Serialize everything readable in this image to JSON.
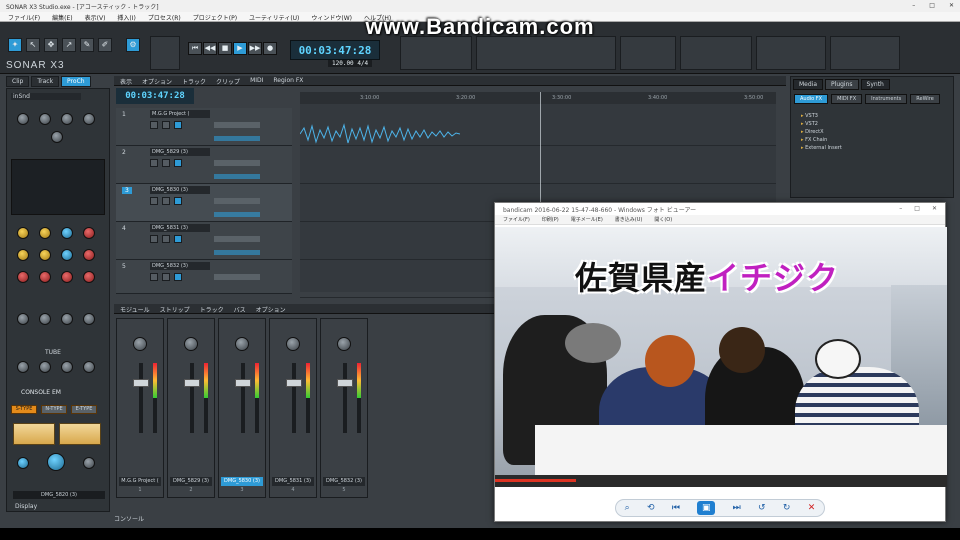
{
  "watermark": "www.Bandicam.com",
  "app": {
    "title": "SONAR X3 Studio.exe - [アコースティック - トラック]",
    "logo": "SONAR X3",
    "menus": [
      "ファイル(F)",
      "編集(E)",
      "表示(V)",
      "挿入(I)",
      "プロセス(R)",
      "プロジェクト(P)",
      "ユーティリティ(U)",
      "ウィンドウ(W)",
      "ヘルプ(H)"
    ],
    "window_controls": [
      "–",
      "□",
      "✕"
    ]
  },
  "transport": {
    "clock": "00:03:47:28",
    "tempo": "120.00",
    "meter": "4/4",
    "buttons": [
      "⏮",
      "◀◀",
      "■",
      "▶",
      "▶▶",
      "●"
    ]
  },
  "inspector": {
    "tabs": [
      "Clip",
      "Track",
      "ProCh"
    ],
    "active_tab": "ProCh",
    "track_name": "inSnd",
    "section_console": "CONSOLE EM",
    "section_tube": "TUBE",
    "buttons": [
      "S-TYPE",
      "N-TYPE",
      "E-TYPE"
    ],
    "bottom_name": "DMG_5820 (3)",
    "display_label": "Display"
  },
  "trackview": {
    "menus": [
      "表示",
      "オプション",
      "トラック",
      "クリップ",
      "MIDI",
      "Region FX"
    ],
    "now_time": "00:03:47:28",
    "ruler": [
      "3:10:00",
      "3:20:00",
      "3:30:00",
      "3:40:00",
      "3:50:00"
    ],
    "tracks": [
      {
        "num": "1",
        "name": "M.G.G Project ("
      },
      {
        "num": "2",
        "name": "DMG_5829 (3)"
      },
      {
        "num": "3",
        "name": "DMG_5830 (3)"
      },
      {
        "num": "4",
        "name": "DMG_5831 (3)"
      },
      {
        "num": "5",
        "name": "DMG_5832 (3)"
      }
    ]
  },
  "console": {
    "menus": [
      "モジュール",
      "ストリップ",
      "トラック",
      "バス",
      "オプション"
    ],
    "strips": [
      {
        "name": "M.G.G Project (",
        "num": "1"
      },
      {
        "name": "DMG_5829 (3)",
        "num": "2"
      },
      {
        "name": "DMG_5830 (3)",
        "num": "3"
      },
      {
        "name": "DMG_5831 (3)",
        "num": "4"
      },
      {
        "name": "DMG_5832 (3)",
        "num": "5"
      }
    ],
    "tab_label": "コンソール"
  },
  "browser": {
    "tabs": [
      "Media",
      "Plugins",
      "Synth"
    ],
    "active_tab": "Plugins",
    "subtabs": [
      "Audio FX",
      "MIDI FX",
      "Instruments",
      "ReWire"
    ],
    "tree": [
      "VST3",
      "VST2",
      "DirectX",
      "FX Chain",
      "External Insert"
    ]
  },
  "player": {
    "title": "bandicam 2016-06-22 15-47-48-660 - Windows フォト ビューアー",
    "menus": [
      "ファイル(F)",
      "印刷(P)",
      "電子メール(E)",
      "書き込み(U)",
      "開く(O)"
    ],
    "caption_main": "佐賀県産",
    "caption_highlight": "イチジク",
    "progress": 0.18
  },
  "colors": {
    "accent": "#2e9bd6",
    "highlight_text": "#c020c0"
  }
}
